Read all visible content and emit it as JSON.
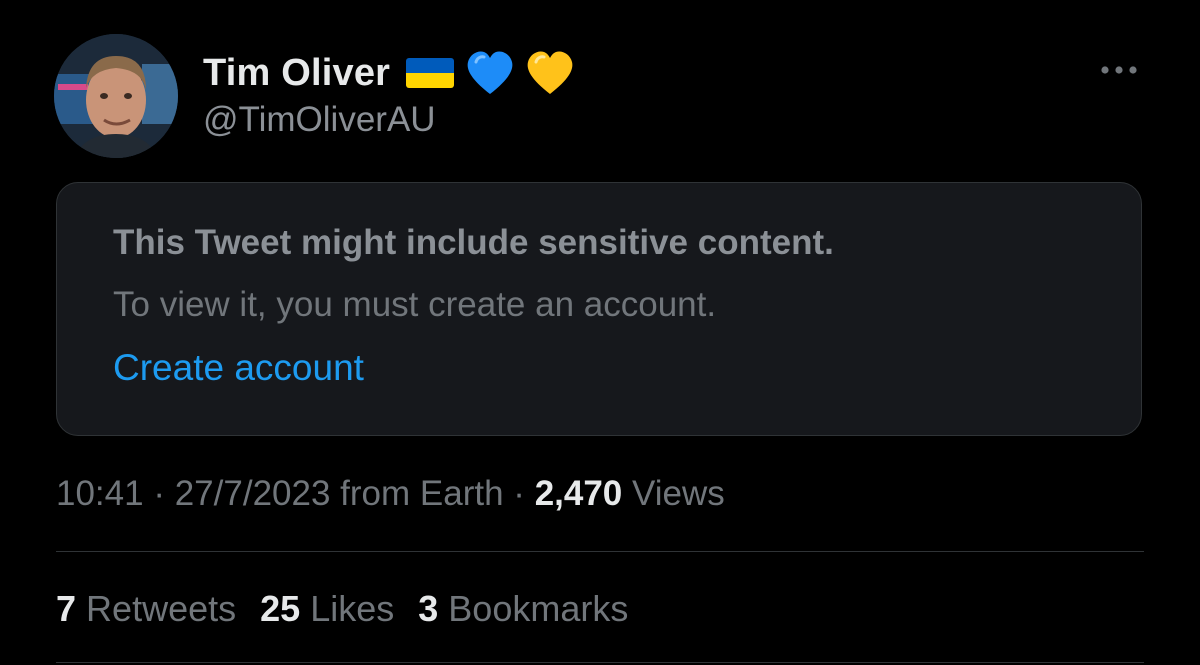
{
  "author": {
    "display_name": "Tim Oliver",
    "handle": "@TimOliverAU",
    "badges": [
      "ukraine-flag-icon",
      "blue-heart-icon",
      "yellow-heart-icon"
    ]
  },
  "header": {
    "more_icon": "more-horizontal-icon"
  },
  "sensitive_notice": {
    "title": "This Tweet might include sensitive content.",
    "body": "To view it, you must create an account.",
    "link_label": "Create account"
  },
  "meta": {
    "time": "10:41",
    "separator": "·",
    "date": "27/7/2023",
    "source": "from Earth",
    "views_count": "2,470",
    "views_label": "Views"
  },
  "stats": {
    "retweets": {
      "count": "7",
      "label": "Retweets"
    },
    "likes": {
      "count": "25",
      "label": "Likes"
    },
    "bookmarks": {
      "count": "3",
      "label": "Bookmarks"
    }
  },
  "colors": {
    "background": "#000000",
    "primary_text": "#e7e9ea",
    "secondary_text": "#71767b",
    "link": "#1d9bf0",
    "border": "#2f3336",
    "card_background": "#16181c",
    "flag_blue": "#005bbb",
    "flag_yellow": "#ffd500",
    "heart_blue": "#1d8cf8",
    "heart_yellow": "#ffcc33"
  }
}
